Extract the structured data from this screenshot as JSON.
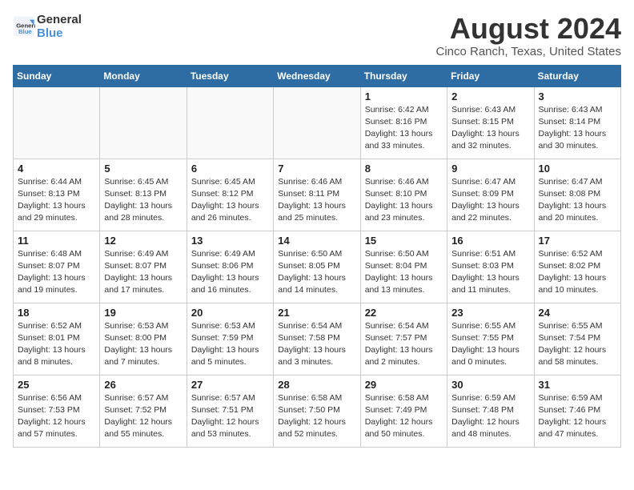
{
  "logo": {
    "line1": "General",
    "line2": "Blue"
  },
  "title": "August 2024",
  "location": "Cinco Ranch, Texas, United States",
  "weekdays": [
    "Sunday",
    "Monday",
    "Tuesday",
    "Wednesday",
    "Thursday",
    "Friday",
    "Saturday"
  ],
  "weeks": [
    [
      {
        "day": "",
        "info": ""
      },
      {
        "day": "",
        "info": ""
      },
      {
        "day": "",
        "info": ""
      },
      {
        "day": "",
        "info": ""
      },
      {
        "day": "1",
        "info": "Sunrise: 6:42 AM\nSunset: 8:16 PM\nDaylight: 13 hours\nand 33 minutes."
      },
      {
        "day": "2",
        "info": "Sunrise: 6:43 AM\nSunset: 8:15 PM\nDaylight: 13 hours\nand 32 minutes."
      },
      {
        "day": "3",
        "info": "Sunrise: 6:43 AM\nSunset: 8:14 PM\nDaylight: 13 hours\nand 30 minutes."
      }
    ],
    [
      {
        "day": "4",
        "info": "Sunrise: 6:44 AM\nSunset: 8:13 PM\nDaylight: 13 hours\nand 29 minutes."
      },
      {
        "day": "5",
        "info": "Sunrise: 6:45 AM\nSunset: 8:13 PM\nDaylight: 13 hours\nand 28 minutes."
      },
      {
        "day": "6",
        "info": "Sunrise: 6:45 AM\nSunset: 8:12 PM\nDaylight: 13 hours\nand 26 minutes."
      },
      {
        "day": "7",
        "info": "Sunrise: 6:46 AM\nSunset: 8:11 PM\nDaylight: 13 hours\nand 25 minutes."
      },
      {
        "day": "8",
        "info": "Sunrise: 6:46 AM\nSunset: 8:10 PM\nDaylight: 13 hours\nand 23 minutes."
      },
      {
        "day": "9",
        "info": "Sunrise: 6:47 AM\nSunset: 8:09 PM\nDaylight: 13 hours\nand 22 minutes."
      },
      {
        "day": "10",
        "info": "Sunrise: 6:47 AM\nSunset: 8:08 PM\nDaylight: 13 hours\nand 20 minutes."
      }
    ],
    [
      {
        "day": "11",
        "info": "Sunrise: 6:48 AM\nSunset: 8:07 PM\nDaylight: 13 hours\nand 19 minutes."
      },
      {
        "day": "12",
        "info": "Sunrise: 6:49 AM\nSunset: 8:07 PM\nDaylight: 13 hours\nand 17 minutes."
      },
      {
        "day": "13",
        "info": "Sunrise: 6:49 AM\nSunset: 8:06 PM\nDaylight: 13 hours\nand 16 minutes."
      },
      {
        "day": "14",
        "info": "Sunrise: 6:50 AM\nSunset: 8:05 PM\nDaylight: 13 hours\nand 14 minutes."
      },
      {
        "day": "15",
        "info": "Sunrise: 6:50 AM\nSunset: 8:04 PM\nDaylight: 13 hours\nand 13 minutes."
      },
      {
        "day": "16",
        "info": "Sunrise: 6:51 AM\nSunset: 8:03 PM\nDaylight: 13 hours\nand 11 minutes."
      },
      {
        "day": "17",
        "info": "Sunrise: 6:52 AM\nSunset: 8:02 PM\nDaylight: 13 hours\nand 10 minutes."
      }
    ],
    [
      {
        "day": "18",
        "info": "Sunrise: 6:52 AM\nSunset: 8:01 PM\nDaylight: 13 hours\nand 8 minutes."
      },
      {
        "day": "19",
        "info": "Sunrise: 6:53 AM\nSunset: 8:00 PM\nDaylight: 13 hours\nand 7 minutes."
      },
      {
        "day": "20",
        "info": "Sunrise: 6:53 AM\nSunset: 7:59 PM\nDaylight: 13 hours\nand 5 minutes."
      },
      {
        "day": "21",
        "info": "Sunrise: 6:54 AM\nSunset: 7:58 PM\nDaylight: 13 hours\nand 3 minutes."
      },
      {
        "day": "22",
        "info": "Sunrise: 6:54 AM\nSunset: 7:57 PM\nDaylight: 13 hours\nand 2 minutes."
      },
      {
        "day": "23",
        "info": "Sunrise: 6:55 AM\nSunset: 7:55 PM\nDaylight: 13 hours\nand 0 minutes."
      },
      {
        "day": "24",
        "info": "Sunrise: 6:55 AM\nSunset: 7:54 PM\nDaylight: 12 hours\nand 58 minutes."
      }
    ],
    [
      {
        "day": "25",
        "info": "Sunrise: 6:56 AM\nSunset: 7:53 PM\nDaylight: 12 hours\nand 57 minutes."
      },
      {
        "day": "26",
        "info": "Sunrise: 6:57 AM\nSunset: 7:52 PM\nDaylight: 12 hours\nand 55 minutes."
      },
      {
        "day": "27",
        "info": "Sunrise: 6:57 AM\nSunset: 7:51 PM\nDaylight: 12 hours\nand 53 minutes."
      },
      {
        "day": "28",
        "info": "Sunrise: 6:58 AM\nSunset: 7:50 PM\nDaylight: 12 hours\nand 52 minutes."
      },
      {
        "day": "29",
        "info": "Sunrise: 6:58 AM\nSunset: 7:49 PM\nDaylight: 12 hours\nand 50 minutes."
      },
      {
        "day": "30",
        "info": "Sunrise: 6:59 AM\nSunset: 7:48 PM\nDaylight: 12 hours\nand 48 minutes."
      },
      {
        "day": "31",
        "info": "Sunrise: 6:59 AM\nSunset: 7:46 PM\nDaylight: 12 hours\nand 47 minutes."
      }
    ]
  ]
}
